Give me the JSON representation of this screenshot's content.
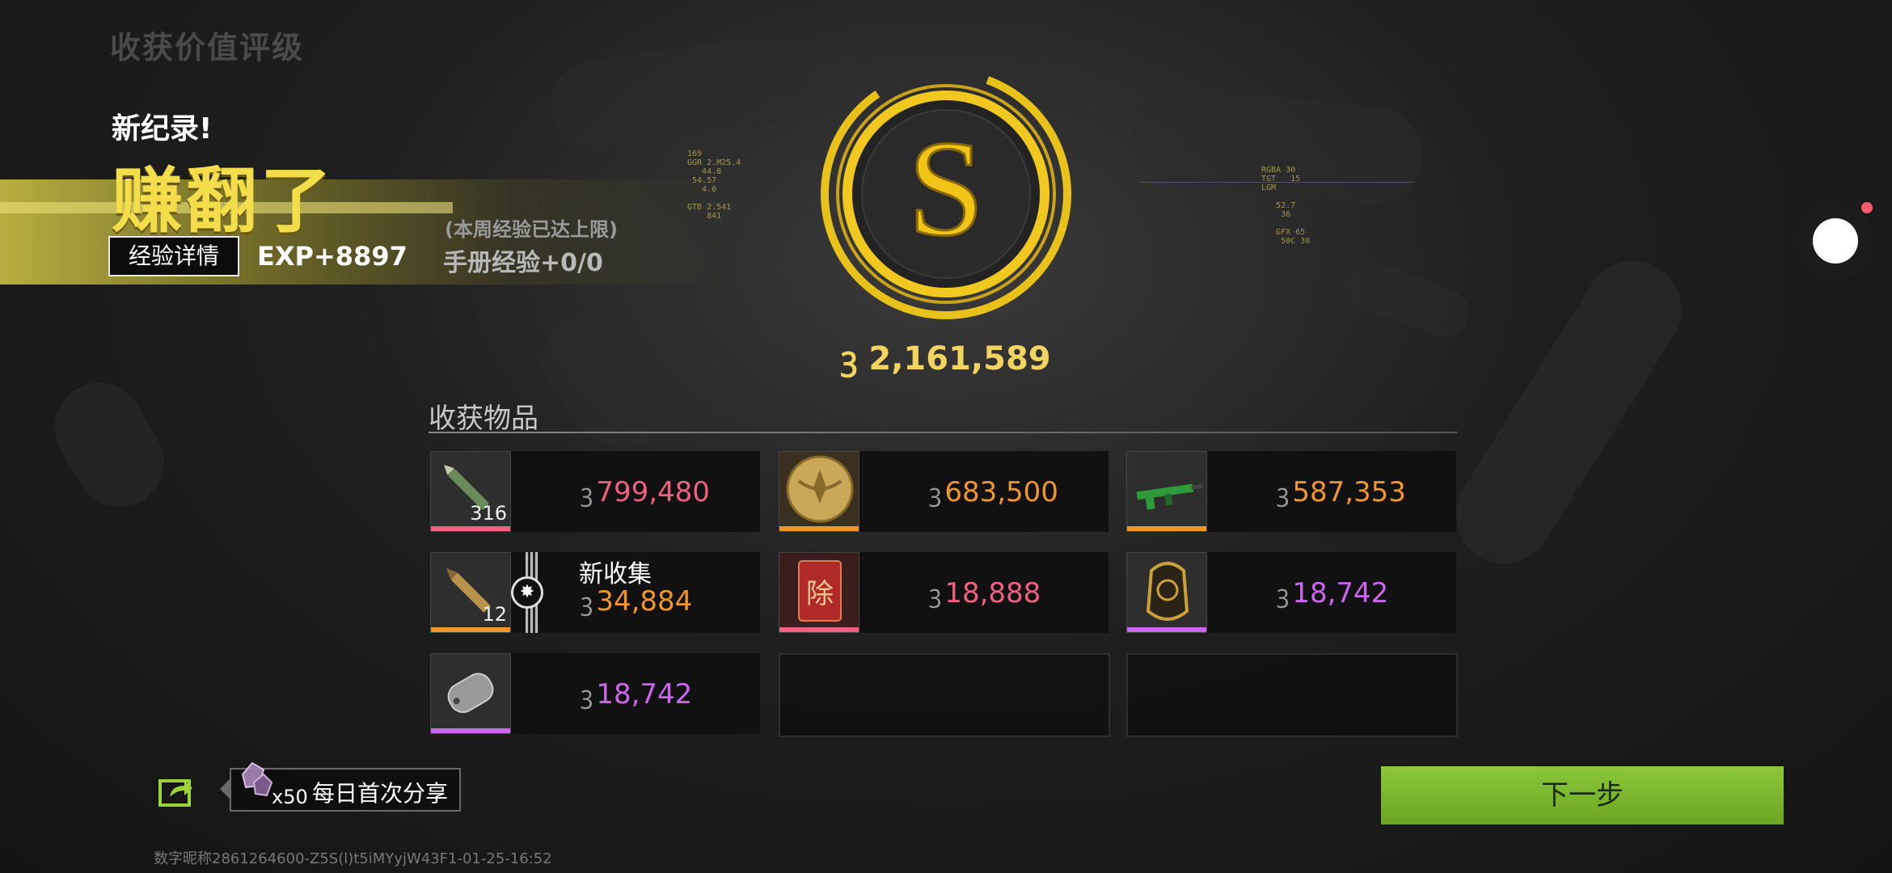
{
  "header": {
    "screen_title": "收获价值评级"
  },
  "result": {
    "new_record": "新纪录!",
    "headline": "赚翻了",
    "exp_detail_label": "经验详情",
    "exp_gain": "EXP+8897",
    "weekly_cap_note": "(本周经验已达上限)",
    "manual_exp": "手册经验+0/0"
  },
  "rating": {
    "grade": "S",
    "total_value": "2,161,589",
    "accent": "#f2c416"
  },
  "loot": {
    "title": "收获物品",
    "items": [
      {
        "icon": "ammo-rounds-icon",
        "qty": "316",
        "price": "799,480",
        "price_color": "#f06080",
        "rarity_color": "#f06080"
      },
      {
        "icon": "gold-emblem-coin-icon",
        "qty": "",
        "price": "683,500",
        "price_color": "#f0962a",
        "rarity_color": "#f0962a"
      },
      {
        "icon": "green-rifle-icon",
        "qty": "",
        "price": "587,353",
        "price_color": "#f0962a",
        "rarity_color": "#f0962a"
      },
      {
        "icon": "bullet-cartridge-icon",
        "qty": "12",
        "price": "34,884",
        "price_color": "#f0962a",
        "rarity_color": "#f0962a",
        "new_tag": "新收集"
      },
      {
        "icon": "red-envelope-icon",
        "qty": "",
        "price": "18,888",
        "price_color": "#f06080",
        "rarity_color": "#f06080",
        "glyph": "除"
      },
      {
        "icon": "ornate-tag-icon",
        "qty": "",
        "price": "18,742",
        "price_color": "#cc66ee",
        "rarity_color": "#cc66ee"
      },
      {
        "icon": "dog-tag-icon",
        "qty": "",
        "price": "18,742",
        "price_color": "#cc66ee",
        "rarity_color": "#cc66ee"
      }
    ]
  },
  "share": {
    "reward_count": "x50",
    "label": "每日首次分享"
  },
  "actions": {
    "next_label": "下一步"
  },
  "footer": {
    "watermark": "数字昵称2861264600-Z5S(l)t5iMYyjW43F1-01-25-16:52"
  }
}
